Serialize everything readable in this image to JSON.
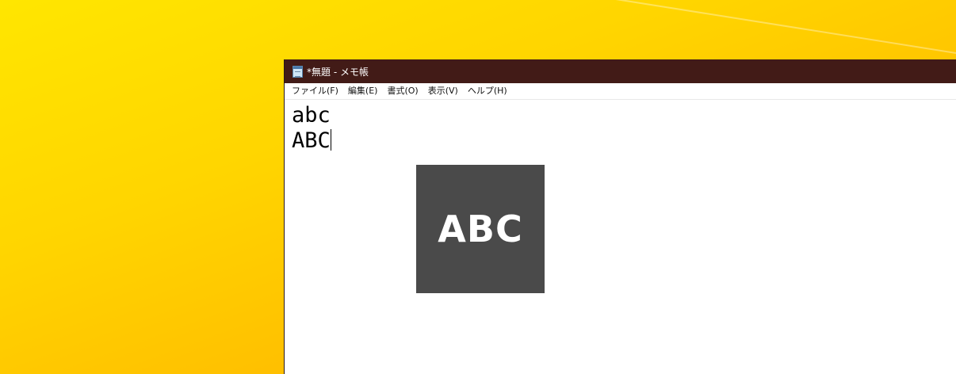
{
  "window": {
    "title": "*無題 - メモ帳",
    "icon": "notepad-icon"
  },
  "menu": {
    "items": [
      {
        "label": "ファイル(F)"
      },
      {
        "label": "編集(E)"
      },
      {
        "label": "書式(O)"
      },
      {
        "label": "表示(V)"
      },
      {
        "label": "ヘルプ(H)"
      }
    ]
  },
  "editor": {
    "lines": [
      "abc",
      "ABC"
    ]
  },
  "overlay": {
    "label": "ABC",
    "background": "#4a4a4a"
  },
  "colors": {
    "titlebar": "#421b17",
    "desktop": "#ffd500"
  }
}
